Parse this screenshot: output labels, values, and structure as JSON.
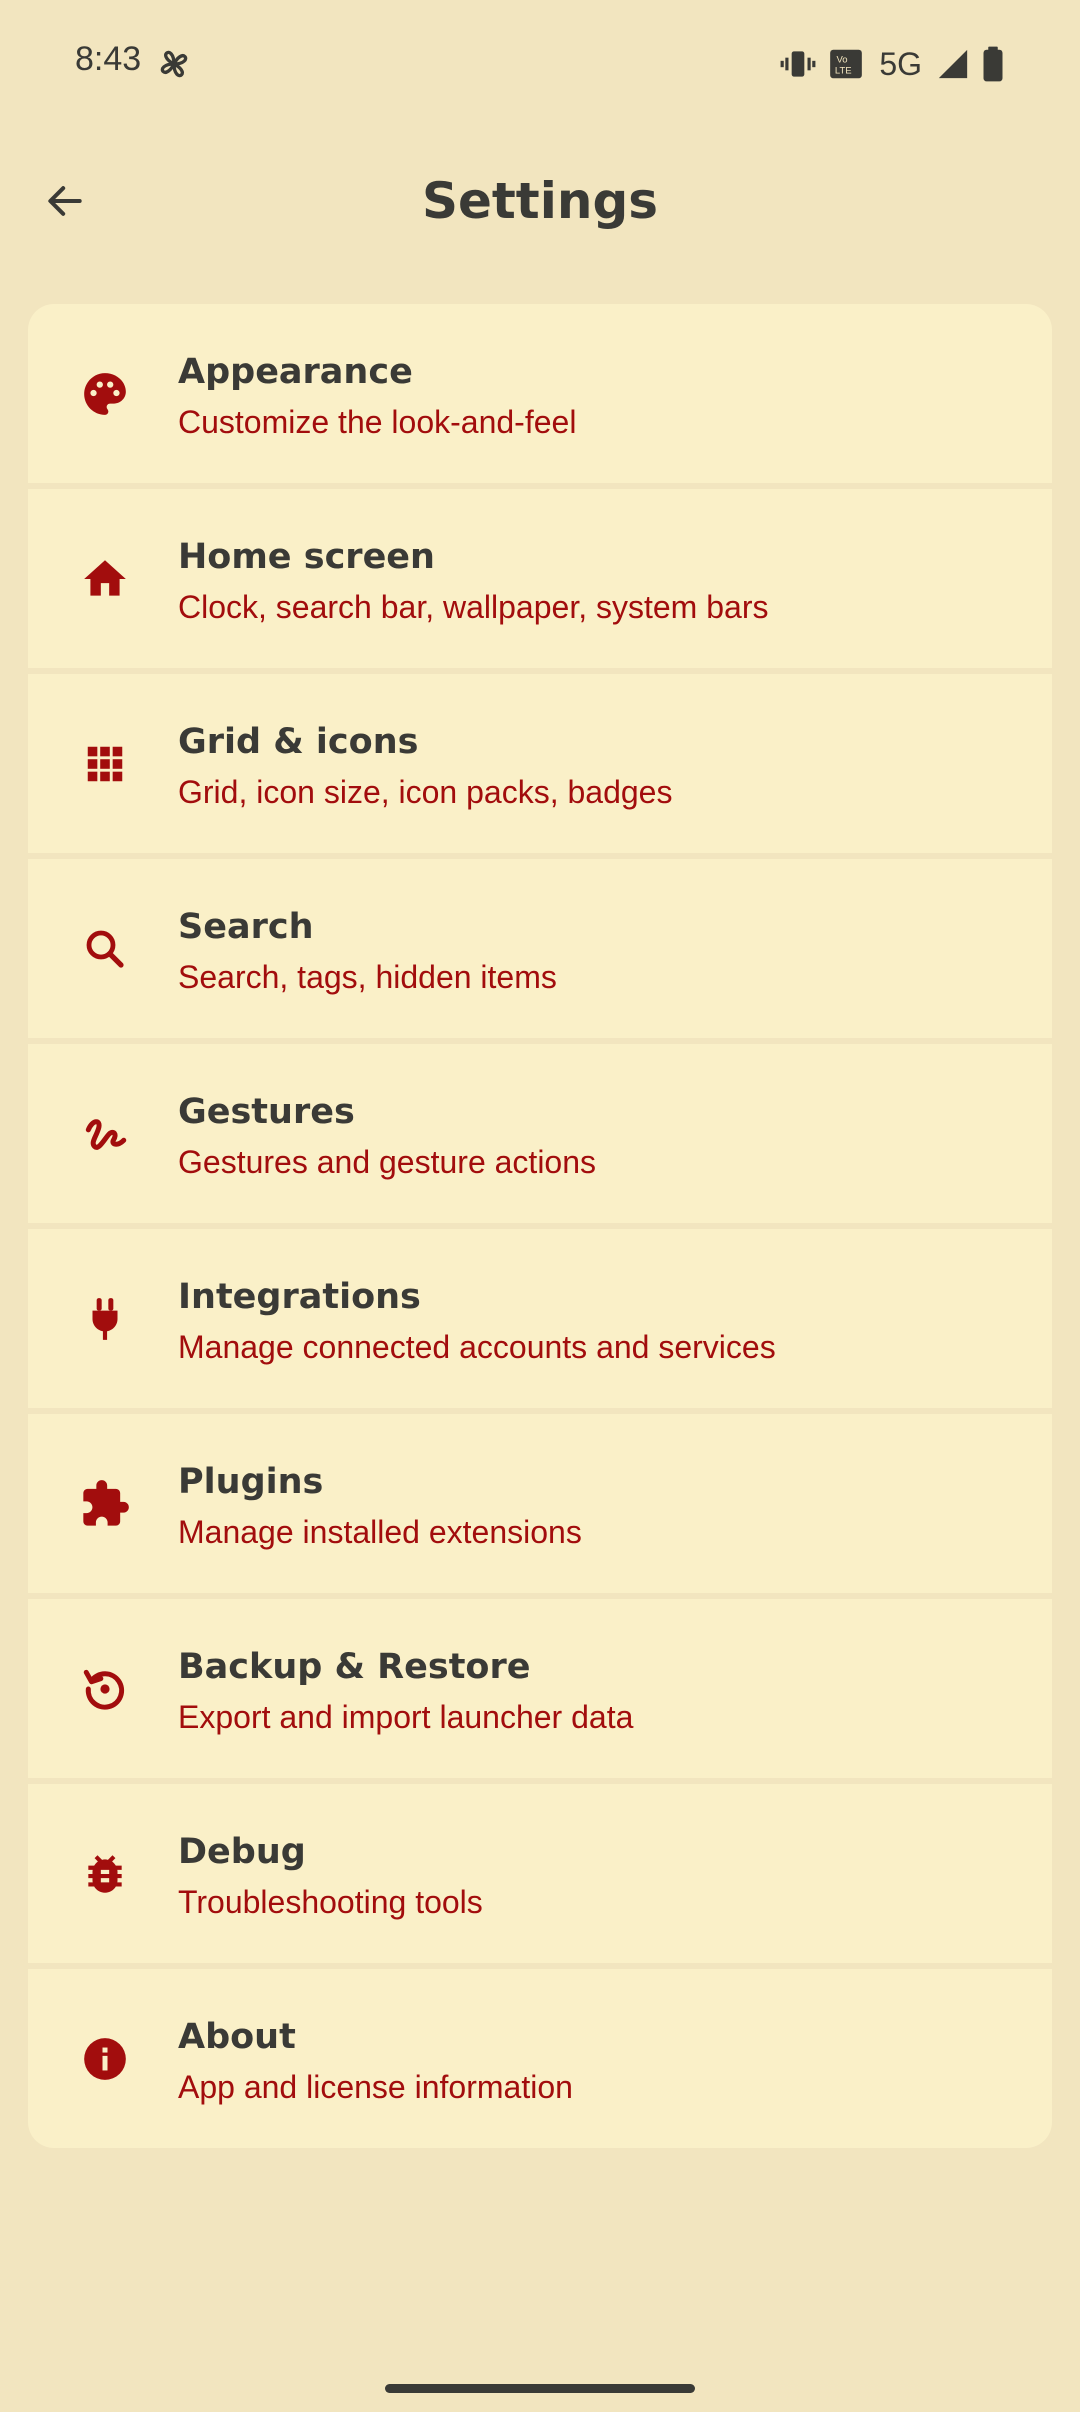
{
  "status_bar": {
    "time": "8:43",
    "network": "5G",
    "icons": [
      "fan-icon",
      "vibrate-icon",
      "volte-icon",
      "signal-icon",
      "battery-icon"
    ]
  },
  "app_bar": {
    "title": "Settings",
    "back_icon": "arrow-back-icon"
  },
  "colors": {
    "background": "#f2e5bf",
    "card": "#faf0c8",
    "accent": "#a20d0d",
    "text": "#3a3a36"
  },
  "settings": [
    {
      "title": "Appearance",
      "subtitle": "Customize the look-and-feel",
      "icon": "palette-icon"
    },
    {
      "title": "Home screen",
      "subtitle": "Clock, search bar, wallpaper, system bars",
      "icon": "home-icon"
    },
    {
      "title": "Grid & icons",
      "subtitle": "Grid, icon size, icon packs, badges",
      "icon": "apps-grid-icon"
    },
    {
      "title": "Search",
      "subtitle": "Search, tags, hidden items",
      "icon": "search-icon"
    },
    {
      "title": "Gestures",
      "subtitle": "Gestures and gesture actions",
      "icon": "gesture-icon"
    },
    {
      "title": "Integrations",
      "subtitle": "Manage connected accounts and services",
      "icon": "plug-icon"
    },
    {
      "title": "Plugins",
      "subtitle": "Manage installed extensions",
      "icon": "puzzle-icon"
    },
    {
      "title": "Backup & Restore",
      "subtitle": "Export and import launcher data",
      "icon": "restore-icon"
    },
    {
      "title": "Debug",
      "subtitle": "Troubleshooting tools",
      "icon": "bug-icon"
    },
    {
      "title": "About",
      "subtitle": "App and license information",
      "icon": "info-icon"
    }
  ]
}
